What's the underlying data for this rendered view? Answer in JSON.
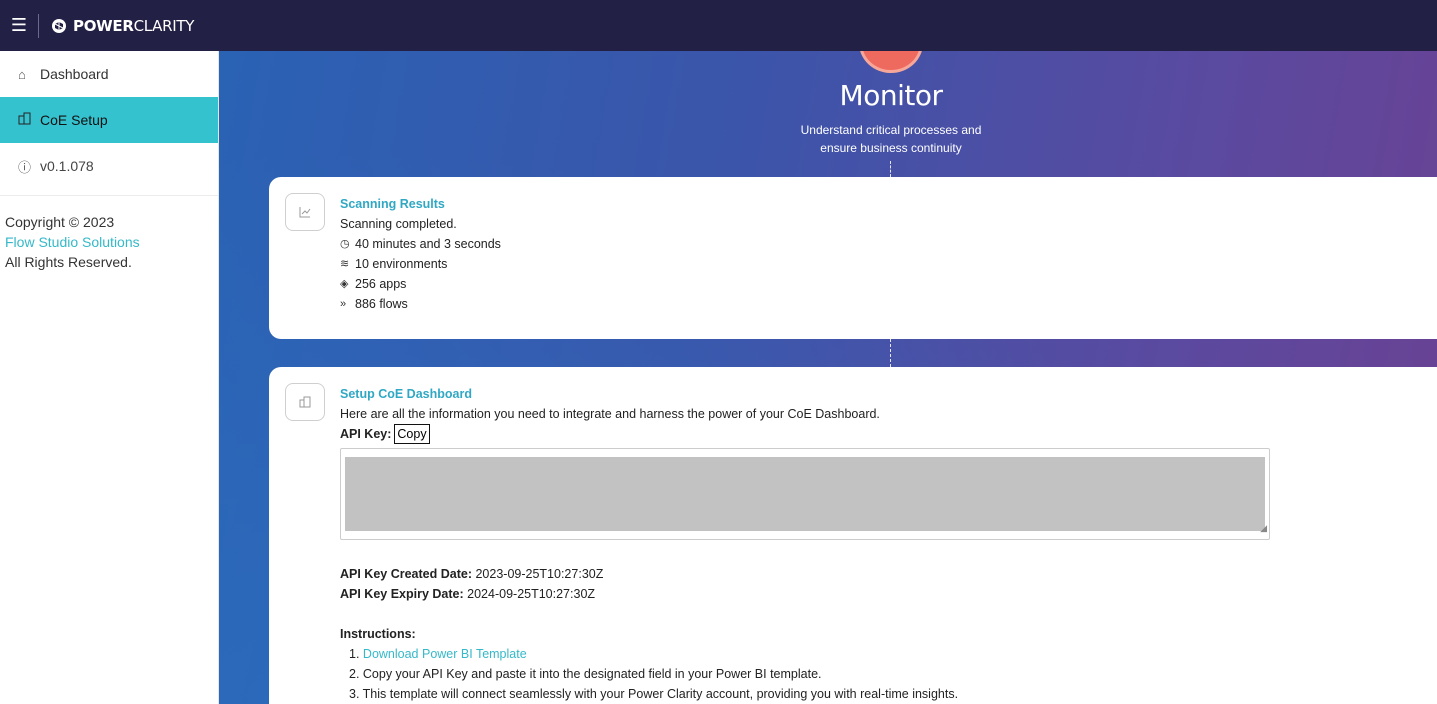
{
  "topbar": {
    "menu_icon": "hamburger-menu-icon",
    "brand_bold": "POWER",
    "brand_light": "CLARITY"
  },
  "sidebar": {
    "items": [
      {
        "icon": "home-icon",
        "label": "Dashboard"
      },
      {
        "icon": "building-icon",
        "label": "CoE Setup",
        "active": true
      },
      {
        "icon": "info-icon",
        "label": "v0.1.078"
      }
    ],
    "copyright_line1": "Copyright © 2023",
    "company_link": "Flow Studio Solutions",
    "rights": "All Rights Reserved."
  },
  "hero": {
    "title": "Monitor",
    "subtitle_line1": "Understand critical processes and",
    "subtitle_line2": "ensure business continuity"
  },
  "scanning": {
    "title": "Scanning Results",
    "status": "Scanning completed.",
    "duration": "40 minutes and 3 seconds",
    "environments": "10 environments",
    "apps": "256 apps",
    "flows": "886 flows"
  },
  "coe": {
    "title": "Setup CoE Dashboard",
    "description": "Here are all the information you need to integrate and harness the power of your CoE Dashboard.",
    "api_key_label": "API Key:",
    "copy_label": "Copy",
    "created_label": "API Key Created Date:",
    "created_value": "2023-09-25T10:27:30Z",
    "expiry_label": "API Key Expiry Date:",
    "expiry_value": "2024-09-25T10:27:30Z",
    "instructions_label": "Instructions:",
    "step1_num": "1.",
    "step1": "Download Power BI Template",
    "step2": "2. Copy your API Key and paste it into the designated field in your Power BI template.",
    "step3": "3. This template will connect seamlessly with your Power Clarity account, providing you with real-time insights."
  },
  "colors": {
    "topbar": "#222044",
    "accent": "#35c2cf",
    "link": "#35b9c9",
    "title": "#30a8c4",
    "hero_circle": "#ee6a5f"
  }
}
